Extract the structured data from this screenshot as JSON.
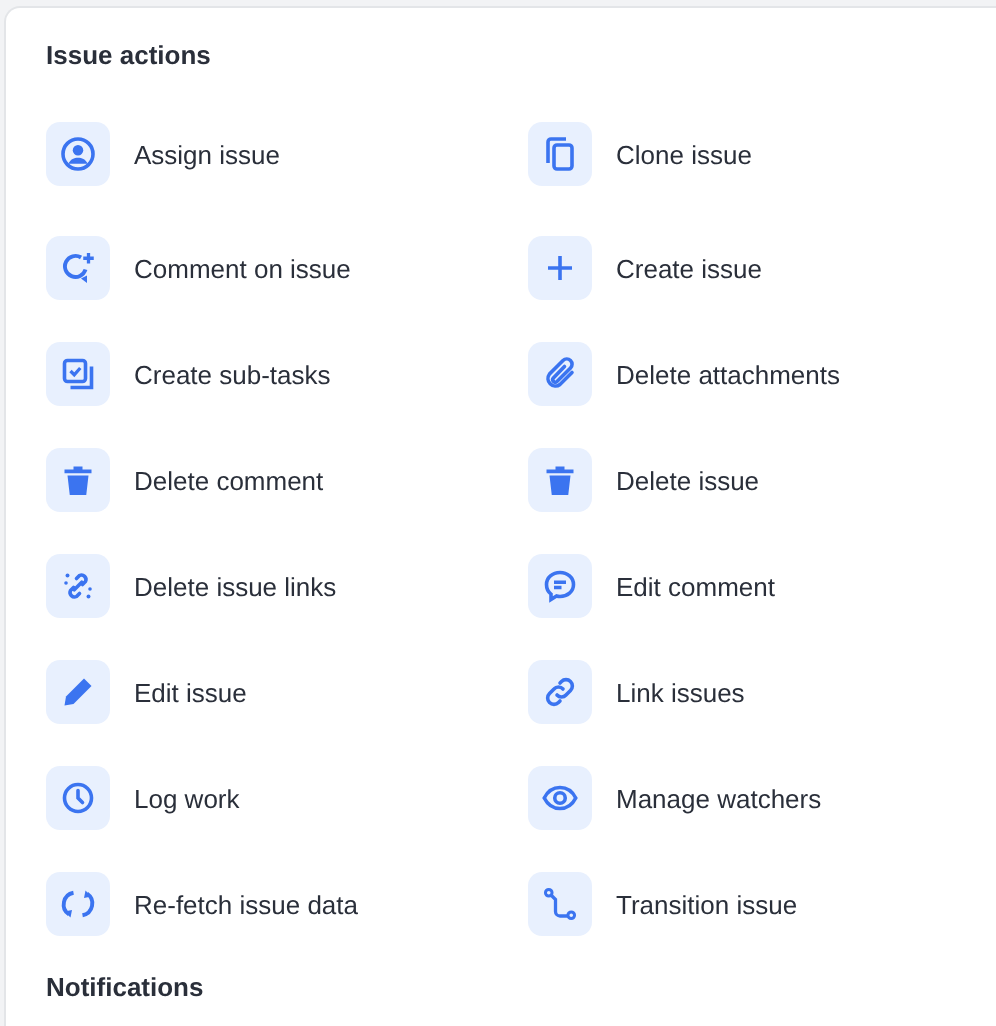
{
  "sections": [
    {
      "title": "Issue actions",
      "actions": [
        {
          "label": "Assign issue",
          "kind": "user"
        },
        {
          "label": "Clone issue",
          "kind": "clone"
        },
        {
          "label": "Comment on issue",
          "kind": "comment-add"
        },
        {
          "label": "Create issue",
          "kind": "plus"
        },
        {
          "label": "Create sub-tasks",
          "kind": "subtasks"
        },
        {
          "label": "Delete attachments",
          "kind": "paperclip"
        },
        {
          "label": "Delete comment",
          "kind": "trash"
        },
        {
          "label": "Delete issue",
          "kind": "trash"
        },
        {
          "label": "Delete issue links",
          "kind": "unlink"
        },
        {
          "label": "Edit comment",
          "kind": "chat"
        },
        {
          "label": "Edit issue",
          "kind": "pencil"
        },
        {
          "label": "Link issues",
          "kind": "link"
        },
        {
          "label": "Log work",
          "kind": "clock"
        },
        {
          "label": "Manage watchers",
          "kind": "eye"
        },
        {
          "label": "Re-fetch issue data",
          "kind": "refresh"
        },
        {
          "label": "Transition issue",
          "kind": "transition"
        }
      ]
    },
    {
      "title": "Notifications"
    }
  ]
}
